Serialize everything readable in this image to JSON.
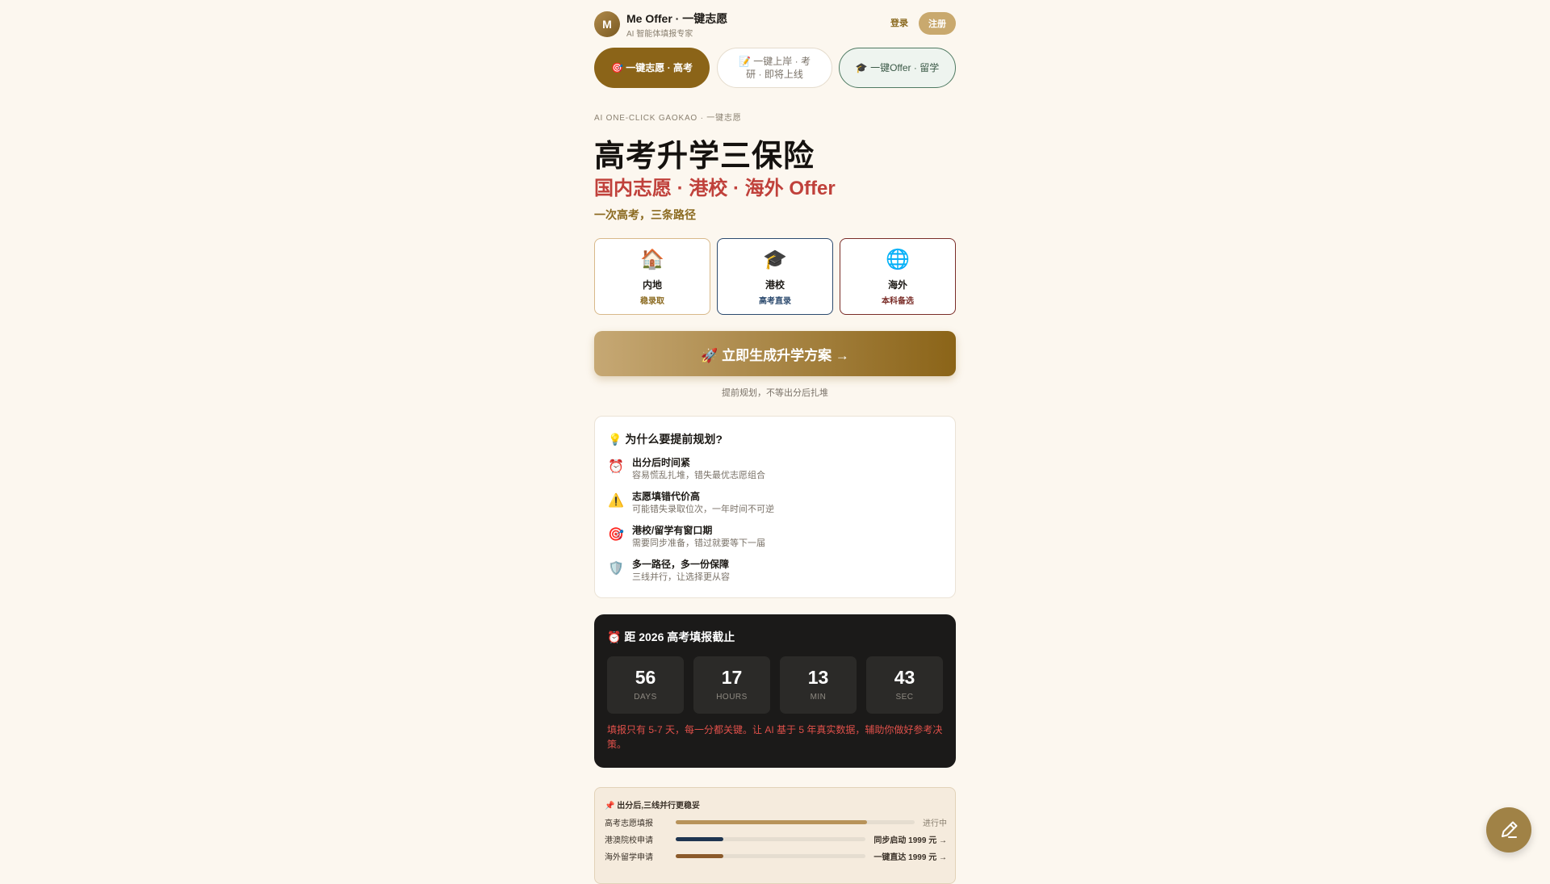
{
  "header": {
    "avatar_letter": "M",
    "brand": "Me Offer · 一键志愿",
    "subtitle": "AI 智能体填报专家",
    "login": "登录",
    "signup": "注册"
  },
  "tabs": [
    {
      "label": "🎯 一键志愿 · 高考"
    },
    {
      "label": "📝 一键上岸 · 考研 · 即将上线"
    },
    {
      "label": "🎓 一键Offer · 留学"
    }
  ],
  "hero": {
    "eyebrow": "AI ONE-CLICK GAOKAO · 一键志愿",
    "title": "高考升学三保险",
    "subtitle": "国内志愿 · 港校 · 海外 Offer",
    "tagline": "一次高考，三条路径"
  },
  "paths": [
    {
      "icon": "🏠",
      "title": "内地",
      "sub": "稳录取"
    },
    {
      "icon": "🎓",
      "title": "港校",
      "sub": "高考直录"
    },
    {
      "icon": "🌐",
      "title": "海外",
      "sub": "本科备选"
    }
  ],
  "cta": {
    "label": "🚀 立即生成升学方案 →",
    "note": "提前规划，不等出分后扎堆"
  },
  "why": {
    "title": "💡  为什么要提前规划?",
    "items": [
      {
        "icon": "⏰",
        "title": "出分后时间紧",
        "desc": "容易慌乱扎堆，错失最优志愿组合"
      },
      {
        "icon": "⚠️",
        "title": "志愿填错代价高",
        "desc": "可能错失录取位次，一年时间不可逆"
      },
      {
        "icon": "🎯",
        "title": "港校/留学有窗口期",
        "desc": "需要同步准备，错过就要等下一届"
      },
      {
        "icon": "🛡️",
        "title": "多一路径，多一份保障",
        "desc": "三线并行，让选择更从容"
      }
    ]
  },
  "countdown": {
    "title": "⏰  距 2026 高考填报截止",
    "units": [
      {
        "value": "56",
        "label": "DAYS"
      },
      {
        "value": "17",
        "label": "HOURS"
      },
      {
        "value": "13",
        "label": "MIN"
      },
      {
        "value": "43",
        "label": "SEC"
      }
    ],
    "note": "填报只有 5-7 天，每一分都关键。让 AI 基于 5 年真实数据，辅助你做好参考决策。"
  },
  "progress": {
    "title": "📌 出分后,三线并行更稳妥",
    "rows": [
      {
        "label": "高考志愿填报",
        "fraction": 0.8,
        "status": "进行中",
        "color": "#b8935a"
      },
      {
        "label": "港澳院校申请",
        "fraction": 0.25,
        "status": "同步启动 1999 元 →",
        "color": "#1f3550"
      },
      {
        "label": "海外留学申请",
        "fraction": 0.25,
        "status": "一键直达 1999 元 →",
        "color": "#8b5a2a"
      }
    ]
  },
  "fab": {
    "icon": "pen-icon"
  }
}
